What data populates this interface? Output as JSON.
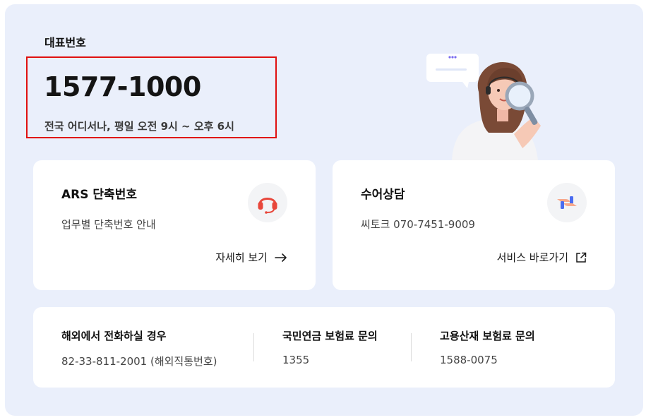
{
  "rep": {
    "label": "대표번호",
    "number": "1577-1000",
    "hours": "전국 어디서나, 평일 오전 9시 ~ 오후 6시"
  },
  "cards": [
    {
      "title": "ARS 단축번호",
      "desc": "업무별 단축번호 안내",
      "link": "자세히 보기",
      "icon": "headset-icon",
      "link_icon": "arrow-right-icon"
    },
    {
      "title": "수어상담",
      "desc": "씨토크 070-7451-9009",
      "link": "서비스 바로가기",
      "icon": "sign-language-icon",
      "link_icon": "external-link-icon"
    }
  ],
  "contacts": [
    {
      "title": "해외에서 전화하실 경우",
      "value": "82-33-811-2001 (해외직통번호)"
    },
    {
      "title": "국민연금 보험료 문의",
      "value": "1355"
    },
    {
      "title": "고용산재 보험료 문의",
      "value": "1588-0075"
    }
  ],
  "colors": {
    "panel_bg": "#eaeffb",
    "highlight": "#e01010",
    "headset": "#e8473b",
    "sign_blue": "#4a6cf0",
    "sign_peach": "#f7a98c"
  }
}
